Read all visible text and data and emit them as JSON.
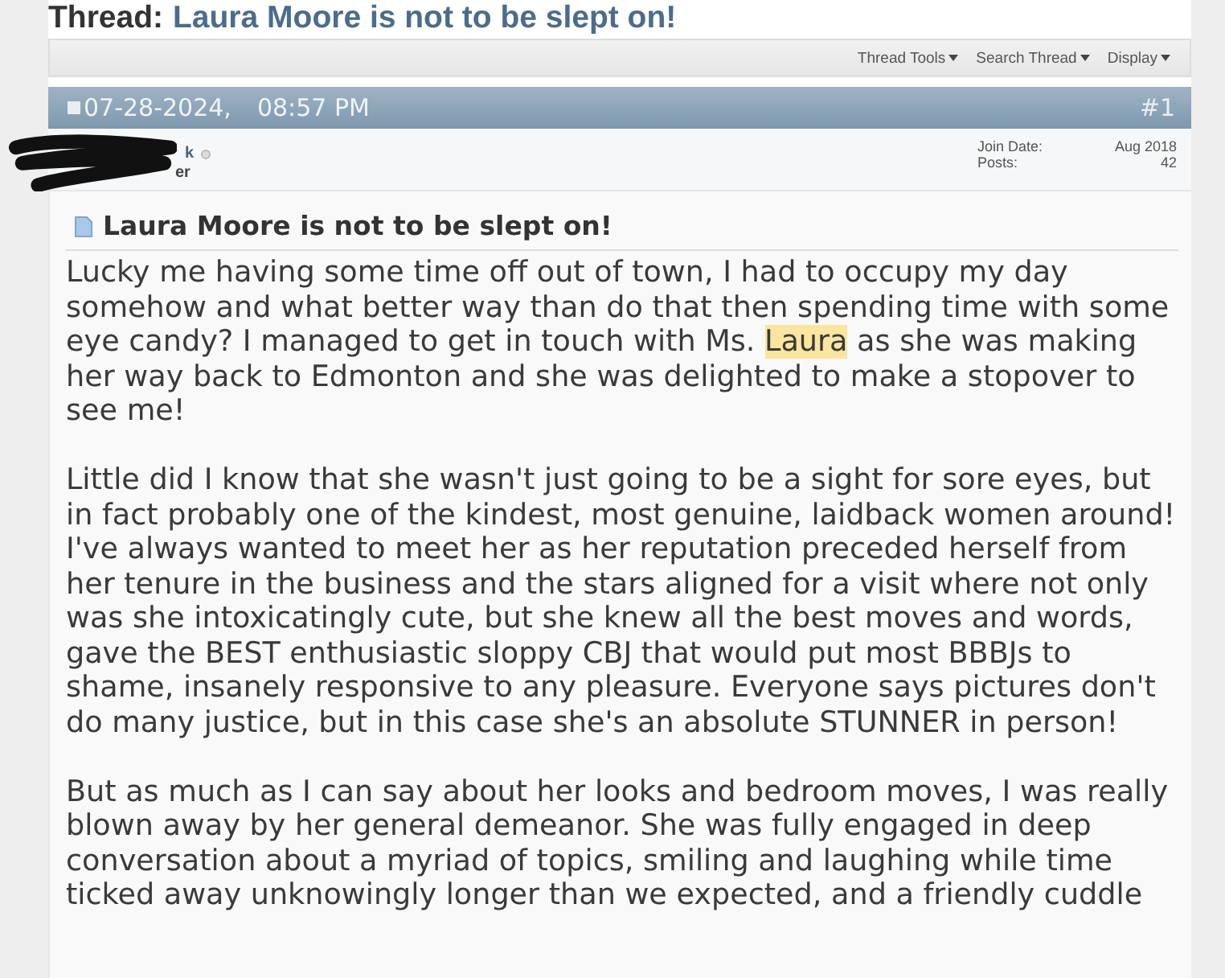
{
  "thread": {
    "label": "Thread:",
    "title": "Laura Moore is not to be slept on!"
  },
  "toolbar": [
    {
      "label": "Thread Tools"
    },
    {
      "label": "Search Thread"
    },
    {
      "label": "Display"
    }
  ],
  "post": {
    "date": "07-28-2024,",
    "time": "08:57 PM",
    "number": "#1",
    "author": {
      "name": "k",
      "online": false,
      "title": "er",
      "redacted": true
    },
    "stats": [
      {
        "label": "Join Date:",
        "value": "Aug 2018"
      },
      {
        "label": "Posts:",
        "value": "42"
      }
    ],
    "title": "Laura Moore is not to be slept on!",
    "paragraphs": [
      [
        {
          "text": "Lucky me having some time off out of town, I had to occupy my day somehow and what better way than do that then spending time with some eye candy? I managed to get in touch with Ms. ",
          "highlighted": false
        },
        {
          "text": "Laura",
          "highlighted": true
        },
        {
          "text": " as she was making her way back to Edmonton and she was delighted to make a stopover to see me!",
          "highlighted": false
        }
      ],
      [
        {
          "text": "Little did I know that she wasn't just going to be a sight for sore eyes, but in fact probably one of the kindest, most genuine, laidback women around! I've always wanted to meet her as her reputation preceded herself from her tenure in the business and the stars aligned for a visit where not only was she intoxicatingly cute, but she knew all the best moves and words, gave the BEST enthusiastic sloppy CBJ that would put most BBBJs to shame, insanely responsive to any pleasure. Everyone says pictures don't do many justice, but in this case she's an absolute STUNNER in person!",
          "highlighted": false
        }
      ],
      [
        {
          "text": "But as much as I can say about her looks and bedroom moves, I was really blown away by her general demeanor. She was fully engaged in deep conversation about a myriad of topics, smiling and laughing while time ticked away unknowingly longer than we expected, and a friendly cuddle",
          "highlighted": false
        }
      ]
    ]
  }
}
